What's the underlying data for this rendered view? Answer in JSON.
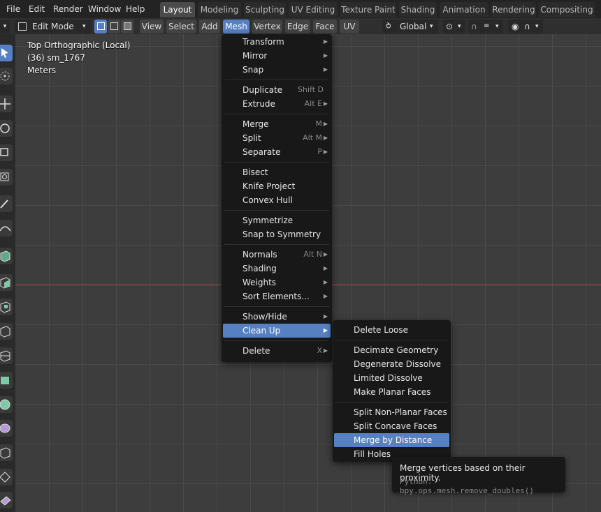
{
  "topbar": {
    "menus": [
      "File",
      "Edit",
      "Render",
      "Window",
      "Help"
    ],
    "workspaces": [
      "Layout",
      "Modeling",
      "Sculpting",
      "UV Editing",
      "Texture Paint",
      "Shading",
      "Animation",
      "Rendering",
      "Compositing"
    ],
    "active_workspace": "Layout"
  },
  "header": {
    "mode": "Edit Mode",
    "menus": [
      "View",
      "Select",
      "Add",
      "Mesh",
      "Vertex",
      "Edge",
      "Face",
      "UV"
    ],
    "active_menu": "Mesh",
    "transform_orientation": "Global"
  },
  "viewport": {
    "view_name": "Top Orthographic (Local)",
    "object_info": "(36) sm_1767",
    "units": "Meters"
  },
  "mesh_menu": {
    "items": [
      {
        "label": "Transform",
        "shortcut": "",
        "submenu": true
      },
      {
        "label": "Mirror",
        "shortcut": "",
        "submenu": true
      },
      {
        "label": "Snap",
        "shortcut": "",
        "submenu": true
      },
      {
        "label": "Duplicate",
        "shortcut": "Shift D",
        "submenu": false
      },
      {
        "label": "Extrude",
        "shortcut": "Alt E",
        "submenu": true
      },
      {
        "label": "Merge",
        "shortcut": "M",
        "submenu": true
      },
      {
        "label": "Split",
        "shortcut": "Alt M",
        "submenu": true
      },
      {
        "label": "Separate",
        "shortcut": "P",
        "submenu": true
      },
      {
        "label": "Bisect",
        "shortcut": "",
        "submenu": false
      },
      {
        "label": "Knife Project",
        "shortcut": "",
        "submenu": false
      },
      {
        "label": "Convex Hull",
        "shortcut": "",
        "submenu": false
      },
      {
        "label": "Symmetrize",
        "shortcut": "",
        "submenu": false
      },
      {
        "label": "Snap to Symmetry",
        "shortcut": "",
        "submenu": false
      },
      {
        "label": "Normals",
        "shortcut": "Alt N",
        "submenu": true
      },
      {
        "label": "Shading",
        "shortcut": "",
        "submenu": true
      },
      {
        "label": "Weights",
        "shortcut": "",
        "submenu": true
      },
      {
        "label": "Sort Elements...",
        "shortcut": "",
        "submenu": true
      },
      {
        "label": "Show/Hide",
        "shortcut": "",
        "submenu": true
      },
      {
        "label": "Clean Up",
        "shortcut": "",
        "submenu": true
      },
      {
        "label": "Delete",
        "shortcut": "X",
        "submenu": true
      }
    ],
    "highlighted": "Clean Up"
  },
  "cleanup_menu": {
    "items": [
      "Delete Loose",
      "Decimate Geometry",
      "Degenerate Dissolve",
      "Limited Dissolve",
      "Make Planar Faces",
      "Split Non-Planar Faces",
      "Split Concave Faces",
      "Merge by Distance",
      "Fill Holes"
    ],
    "highlighted": "Merge by Distance"
  },
  "tooltip": {
    "description": "Merge vertices based on their proximity.",
    "python": "Python: bpy.ops.mesh.remove_doubles()"
  },
  "colors": {
    "accent": "#5680c2",
    "x_axis": "#b34a55",
    "menu_bg": "#181818"
  }
}
